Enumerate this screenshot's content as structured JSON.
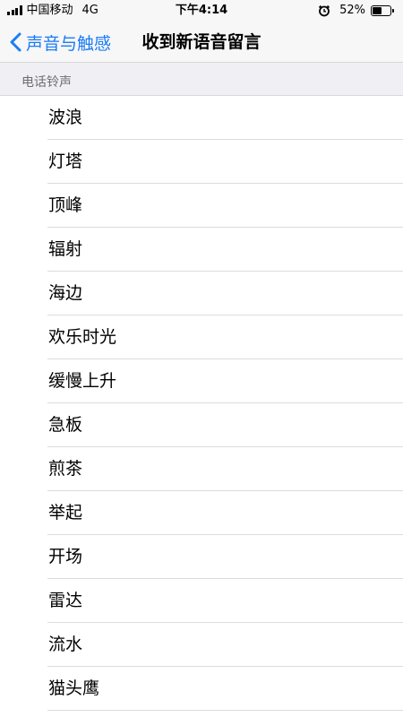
{
  "status_bar": {
    "carrier": "中国移动",
    "network": "4G",
    "time": "下午4:14",
    "battery_text": "52%",
    "battery_level": 0.52,
    "icons": [
      "signal-icon",
      "alarm-icon",
      "battery-icon"
    ]
  },
  "nav": {
    "back_label": "声音与触感",
    "title": "收到新语音留言",
    "accent_color": "#1a7cf6"
  },
  "section": {
    "header": "电话铃声"
  },
  "tones": [
    {
      "label": "波浪"
    },
    {
      "label": "灯塔"
    },
    {
      "label": "顶峰"
    },
    {
      "label": "辐射"
    },
    {
      "label": "海边"
    },
    {
      "label": "欢乐时光"
    },
    {
      "label": "缓慢上升"
    },
    {
      "label": "急板"
    },
    {
      "label": "煎茶"
    },
    {
      "label": "举起"
    },
    {
      "label": "开场"
    },
    {
      "label": "雷达"
    },
    {
      "label": "流水"
    },
    {
      "label": "猫头鹰"
    }
  ]
}
